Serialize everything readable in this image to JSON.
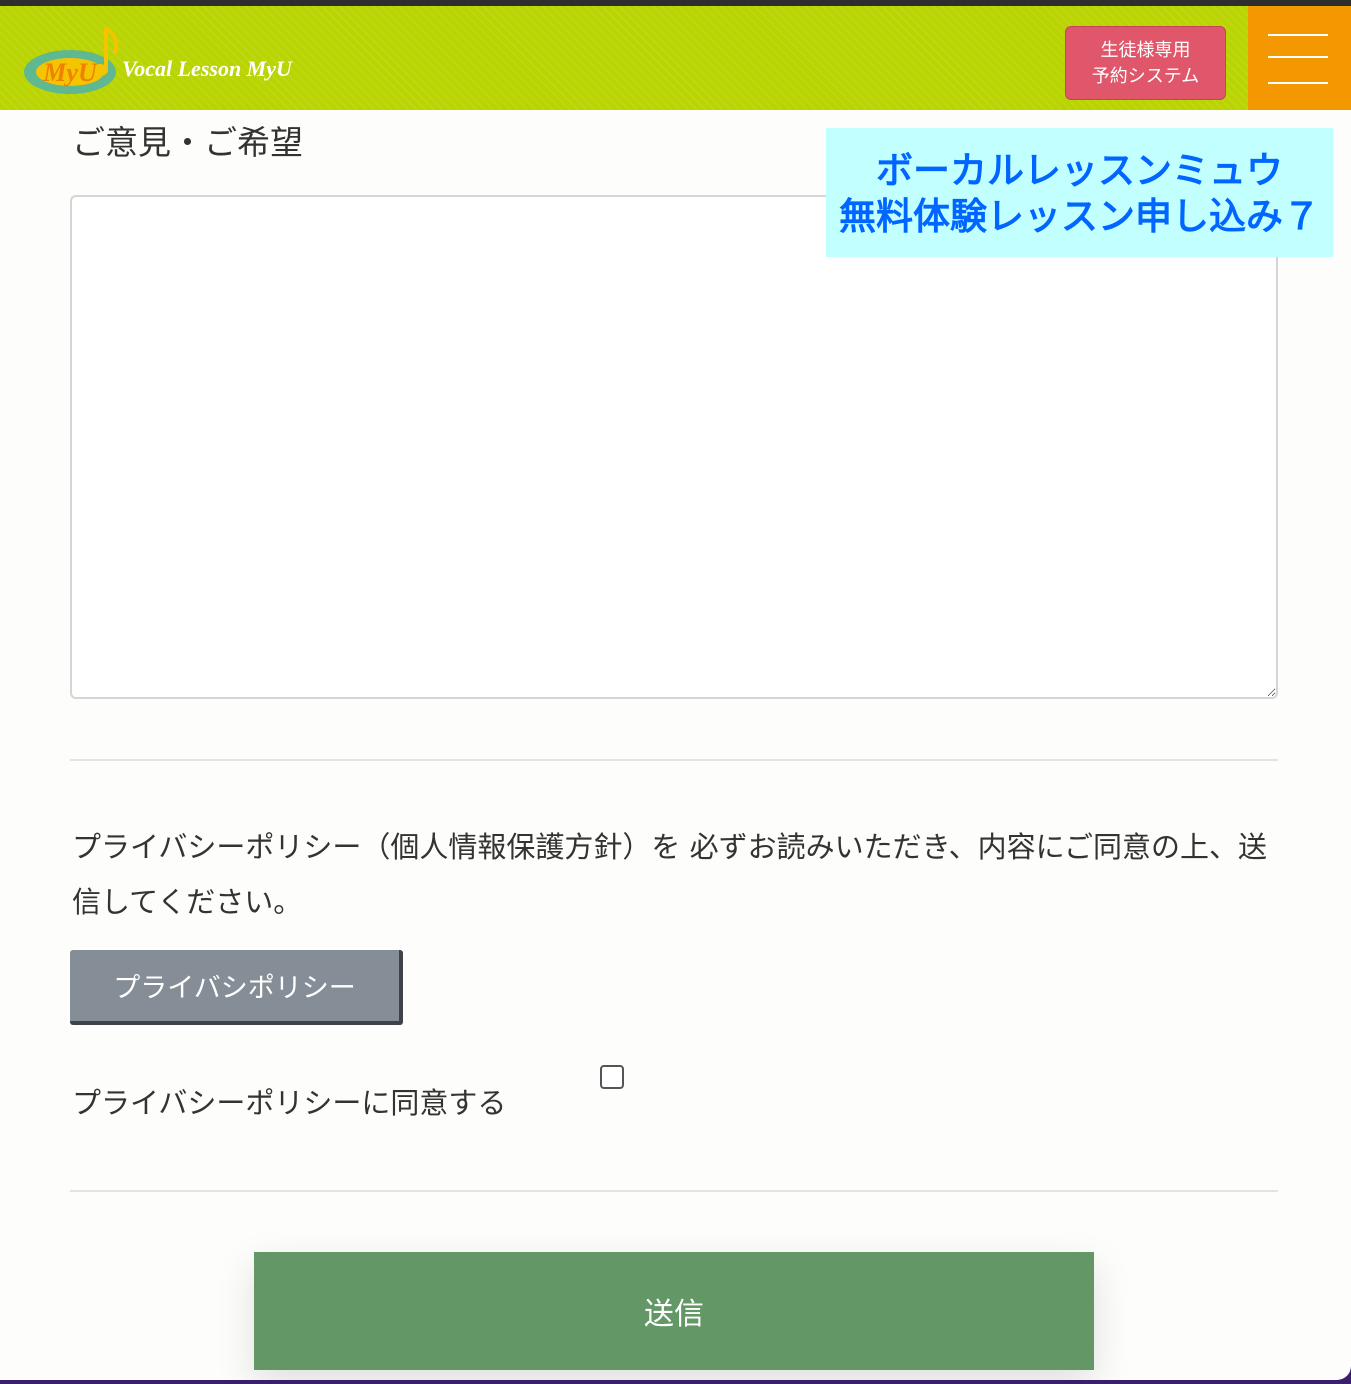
{
  "header": {
    "logo_badge": "MyU",
    "logo_text": "Vocal Lesson MyU",
    "reserve_button": [
      "生徒様専用",
      "予約システム"
    ],
    "menu_icon": "hamburger-menu-icon",
    "background_color": "#b9d400",
    "menu_color": "#f39800",
    "reserve_color": "#e0566a"
  },
  "banner": {
    "lines": [
      "ボーカルレッスンミュウ",
      "無料体験レッスン申し込み７"
    ],
    "background_color": "#c2ffff",
    "text_color": "#0066ff"
  },
  "form": {
    "comment_label": "ご意見・ご希望",
    "comment_value": "",
    "policy_notice": "プライバシーポリシー（個人情報保護方針）を 必ずお読みいただき、内容にご同意の上、送信してください。",
    "policy_button": "プライバシポリシー",
    "agree_label": "プライバシーポリシーに同意する",
    "agree_checked": false,
    "submit_button": "送信",
    "submit_color": "#649766"
  }
}
